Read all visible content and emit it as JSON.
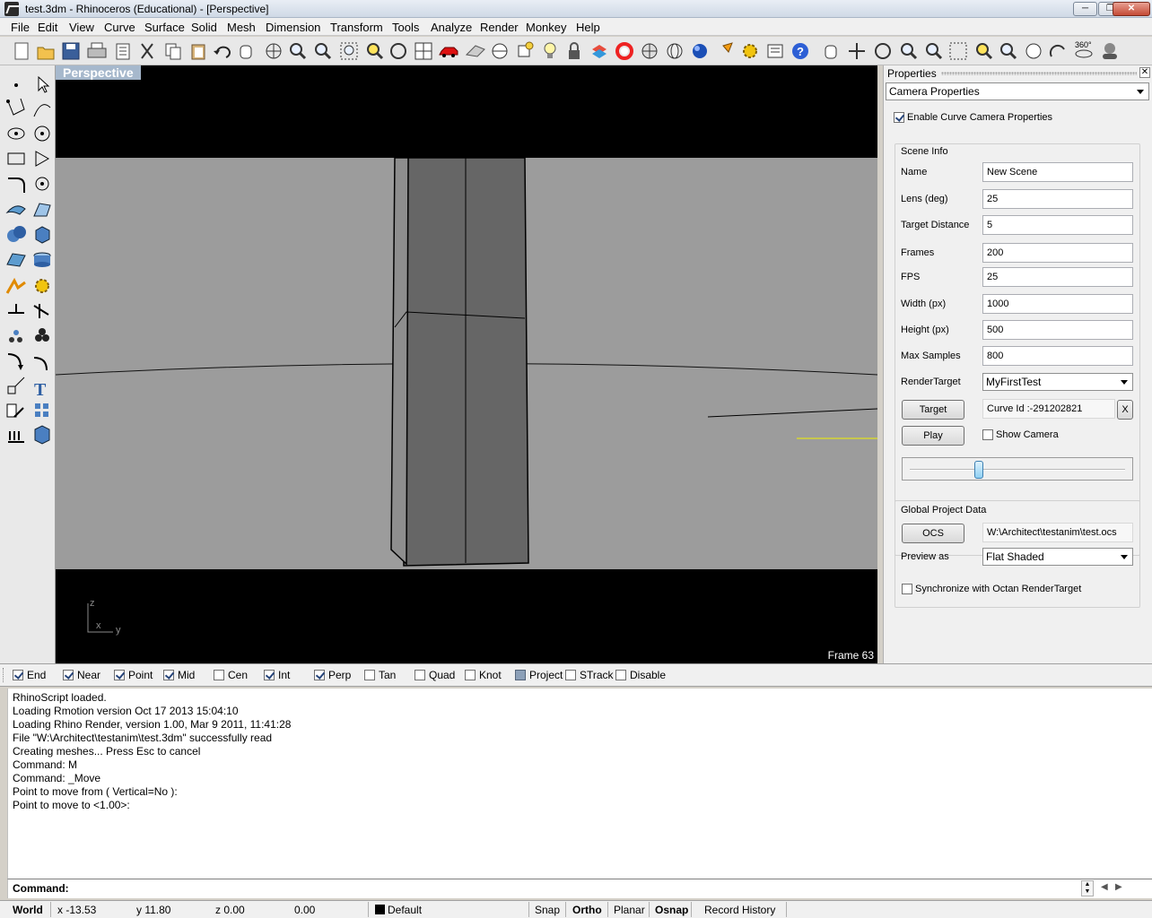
{
  "window": {
    "title": "test.3dm - Rhinoceros (Educational) - [Perspective]",
    "min": "─",
    "max": "❐",
    "close": "✕"
  },
  "menu": [
    "File",
    "Edit",
    "View",
    "Curve",
    "Surface",
    "Solid",
    "Mesh",
    "Dimension",
    "Transform",
    "Tools",
    "Analyze",
    "Render",
    "Monkey",
    "Help"
  ],
  "viewport": {
    "label": "Perspective",
    "frame": "Frame 63",
    "axis": {
      "z": "z",
      "x": "x",
      "y": "y"
    }
  },
  "properties": {
    "title": "Properties",
    "close": "✕",
    "page_select": "Camera Properties",
    "enable_curve_camera": {
      "label": "Enable Curve Camera Properties",
      "checked": true
    },
    "scene_info": {
      "title": "Scene Info",
      "name_label": "Name",
      "name_value": "New Scene",
      "lens_label": "Lens (deg)",
      "lens_value": "25",
      "target_distance_label": "Target Distance",
      "target_distance_value": "5",
      "frames_label": "Frames",
      "frames_value": "200",
      "fps_label": "FPS",
      "fps_value": "25",
      "width_label": "Width (px)",
      "width_value": "1000",
      "height_label": "Height (px)",
      "height_value": "500",
      "max_samples_label": "Max Samples",
      "max_samples_value": "800",
      "render_target_label": "RenderTarget",
      "render_target_value": "MyFirstTest",
      "target_button": "Target",
      "curve_id": "Curve Id :-291202821",
      "clear_button": "X",
      "play_button": "Play",
      "show_camera": {
        "label": "Show Camera",
        "checked": false
      },
      "timeline_fraction": 0.315
    },
    "global": {
      "title": "Global Project Data",
      "ocs_button": "OCS",
      "ocs_path": "W:\\Architect\\testanim\\test.ocs",
      "preview_label": "Preview as",
      "preview_value": "Flat Shaded",
      "sync": {
        "label": "Synchronize with Octan RenderTarget",
        "checked": false
      }
    }
  },
  "osnap": [
    {
      "label": "End",
      "checked": true
    },
    {
      "label": "Near",
      "checked": true
    },
    {
      "label": "Point",
      "checked": true
    },
    {
      "label": "Mid",
      "checked": true
    },
    {
      "label": "Cen",
      "checked": false
    },
    {
      "label": "Int",
      "checked": true
    },
    {
      "label": "Perp",
      "checked": true
    },
    {
      "label": "Tan",
      "checked": false
    },
    {
      "label": "Quad",
      "checked": false
    },
    {
      "label": "Knot",
      "checked": false
    },
    {
      "label": "Project",
      "checked": false,
      "shaded": true
    },
    {
      "label": "STrack",
      "checked": false
    },
    {
      "label": "Disable",
      "checked": false
    }
  ],
  "history": [
    "RhinoScript loaded.",
    "Loading Rmotion version Oct 17 2013  15:04:10",
    "Loading Rhino Render, version 1.00, Mar  9 2011, 11:41:28",
    "File \"W:\\Architect\\testanim\\test.3dm\" successfully read",
    "Creating meshes... Press Esc to cancel",
    "Command: M",
    "Command: _Move",
    "Point to move from ( Vertical=No ):",
    "Point to move to <1.00>:"
  ],
  "command_prompt": "Command:",
  "status": {
    "cplane": "World",
    "x": "x -13.53",
    "y": "y 11.80",
    "z": "z 0.00",
    "dist": "0.00",
    "layer": "Default",
    "snap": "Snap",
    "ortho": "Ortho",
    "planar": "Planar",
    "osnap": "Osnap",
    "record_history": "Record History"
  },
  "colors": {
    "viewport_bg": "#000000",
    "ground": "#9c9c9c",
    "column_face": "#666666",
    "label_bg": "#a6b8cc",
    "curve_highlight": "#f2f200"
  }
}
